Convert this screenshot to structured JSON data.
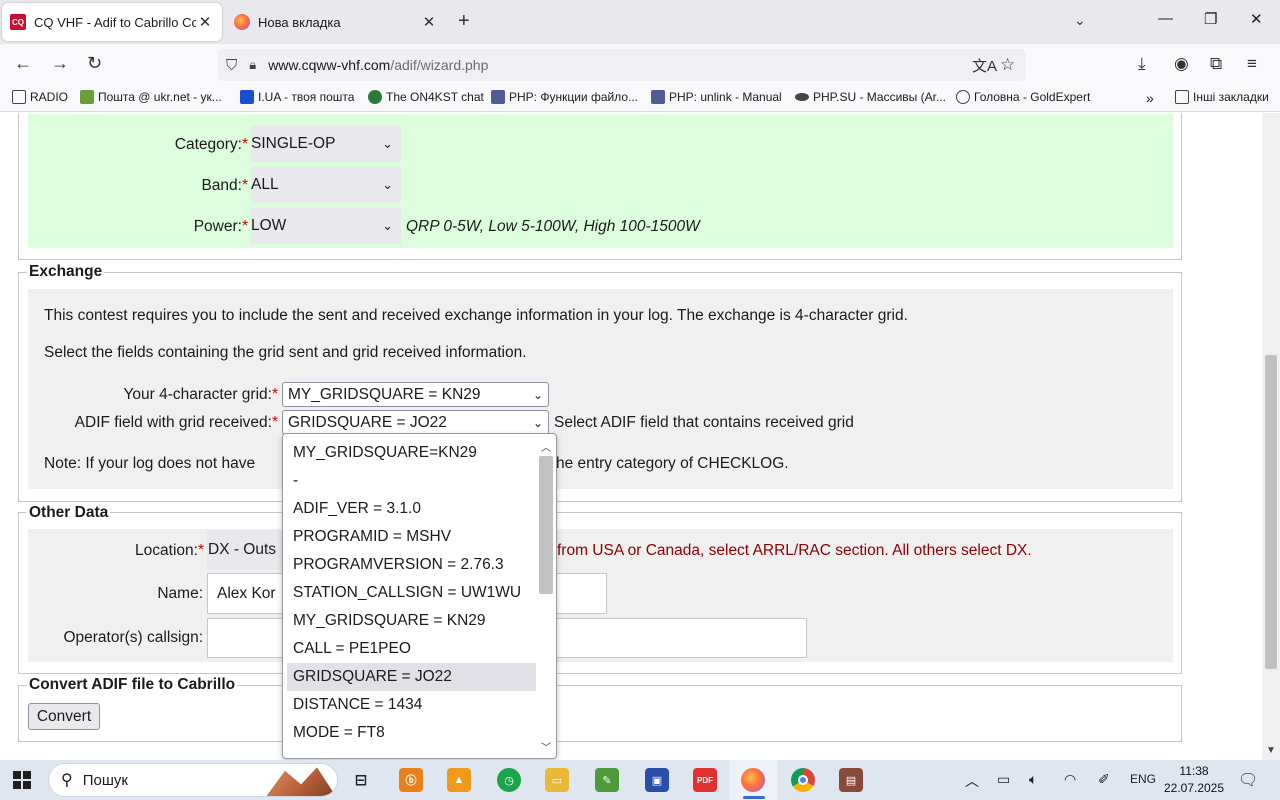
{
  "browser": {
    "tabs": [
      {
        "title": "CQ VHF - Adif to Cabrillo Conve",
        "favicon": "cq-vhf-favicon",
        "active": true
      },
      {
        "title": "Нова вкладка",
        "favicon": "firefox-favicon",
        "active": false
      }
    ],
    "url_host": "www.cqww-vhf.com",
    "url_path": "/adif/wizard.php",
    "bookmarks": [
      "RADIO",
      "Пошта @ ukr.net - ук...",
      "I.UA - твоя пошта",
      "The ON4KST chat",
      "PHP: Функции файло...",
      "PHP: unlink - Manual",
      "PHP.SU - Массивы (Ar...",
      "Головна - GoldExpert",
      "Інші закладки"
    ]
  },
  "category_section": {
    "category_label": "Category:",
    "category_value": "SINGLE-OP",
    "band_label": "Band:",
    "band_value": "ALL",
    "power_label": "Power:",
    "power_value": "LOW",
    "power_hint": "QRP 0-5W, Low 5-100W, High 100-1500W",
    "required_mark": "*"
  },
  "exchange": {
    "legend": "Exchange",
    "intro": "This contest requires you to include the sent and received exchange information in your log. The exchange is 4-character grid.",
    "instruction": "Select the fields containing the grid sent and grid received information.",
    "your_grid_label": "Your 4-character grid:",
    "your_grid_value": "MY_GRIDSQUARE = KN29",
    "received_label": "ADIF field with grid received:",
    "received_value": "GRIDSQUARE = JO22",
    "received_hint": "Select ADIF field that contains received grid",
    "note_start": "Note: If your log does not have",
    "note_end": "he entry category of CHECKLOG."
  },
  "dropdown": {
    "options": [
      "MY_GRIDSQUARE=KN29",
      "-",
      "ADIF_VER = 3.1.0",
      "PROGRAMID = MSHV",
      "PROGRAMVERSION = 2.76.3",
      "STATION_CALLSIGN = UW1WU",
      "MY_GRIDSQUARE = KN29",
      "CALL = PE1PEO",
      "GRIDSQUARE = JO22",
      "DISTANCE = 1434",
      "MODE = FT8"
    ],
    "selected_index": 8
  },
  "other_data": {
    "legend": "Other Data",
    "location_label": "Location:",
    "location_value": "DX - Outs",
    "location_hint": "from USA or Canada, select ARRL/RAC section. All others select DX.",
    "name_label": "Name:",
    "name_value": "Alex Kor",
    "operators_label": "Operator(s) callsign:",
    "operators_value": ""
  },
  "convert": {
    "legend": "Convert ADIF file to Cabrillo",
    "button_label": "Convert"
  },
  "taskbar": {
    "search_placeholder": "Пошук",
    "language": "ENG",
    "time": "11:38",
    "date": "22.07.2025"
  }
}
